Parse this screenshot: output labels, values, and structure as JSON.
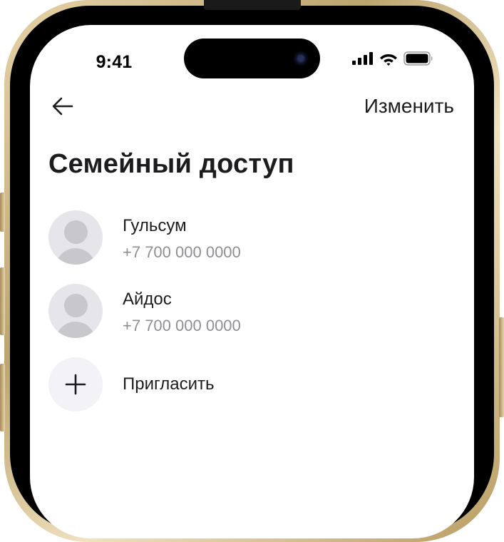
{
  "status_bar": {
    "time": "9:41",
    "icons": [
      "cellular-signal-icon",
      "wifi-icon",
      "battery-icon"
    ]
  },
  "nav": {
    "back_icon": "arrow-left-icon",
    "edit_label": "Изменить"
  },
  "page": {
    "title": "Семейный доступ"
  },
  "members": [
    {
      "name": "Гульсум",
      "phone": "+7 700 000 0000",
      "avatar_icon": "person-placeholder-icon"
    },
    {
      "name": "Айдос",
      "phone": "+7 700 000 0000",
      "avatar_icon": "person-placeholder-icon"
    }
  ],
  "invite": {
    "label": "Пригласить",
    "icon": "plus-icon"
  },
  "colors": {
    "text_primary": "#1c1c1e",
    "text_secondary": "#8e8e93",
    "avatar_bg": "#e5e5ea",
    "avatar_figure": "#c7c7cc",
    "plus_bg": "#f2f2f7",
    "frame_gold": "#bda56f"
  }
}
